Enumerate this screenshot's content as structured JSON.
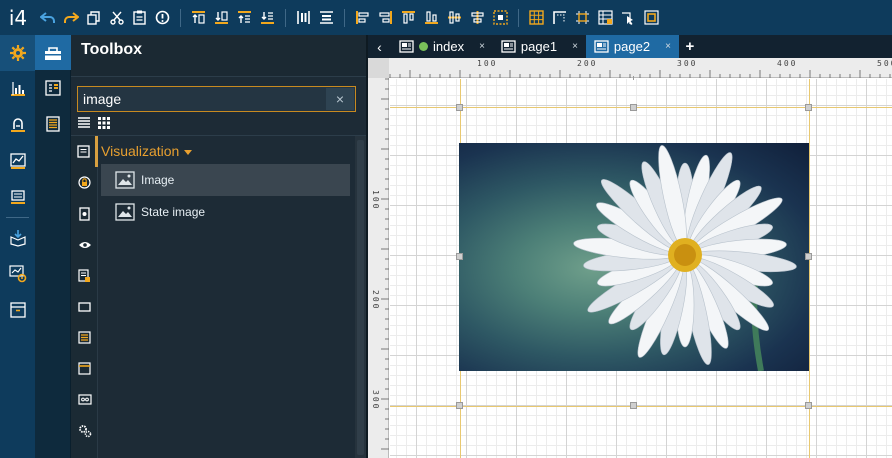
{
  "app": {
    "logo": "i4"
  },
  "toolbox": {
    "title": "Toolbox",
    "search": {
      "value": "image",
      "clear_glyph": "×"
    },
    "category": {
      "label": "Visualization"
    },
    "items": [
      {
        "label": "Image",
        "icon": "image-icon",
        "selected": true
      },
      {
        "label": "State image",
        "icon": "image-icon",
        "selected": false
      }
    ]
  },
  "tabs": [
    {
      "label": "index",
      "close": "×",
      "status_color": "#7ac05a"
    },
    {
      "label": "page1",
      "close": "×"
    },
    {
      "label": "page2",
      "close": "×",
      "active": true
    }
  ],
  "tab_controls": {
    "prev": "‹",
    "add": "+"
  },
  "ruler": {
    "horizontal_labels": [
      "100",
      "200",
      "300",
      "400",
      "500"
    ],
    "vertical_labels": [
      "100",
      "200",
      "300"
    ]
  },
  "colors": {
    "toolbar_bg": "#0e3b5c",
    "accent_active": "#1f6aa3",
    "category_orange": "#e8a030",
    "icon_orange": "#f2a81d",
    "icon_blue": "#4aa3e0"
  }
}
